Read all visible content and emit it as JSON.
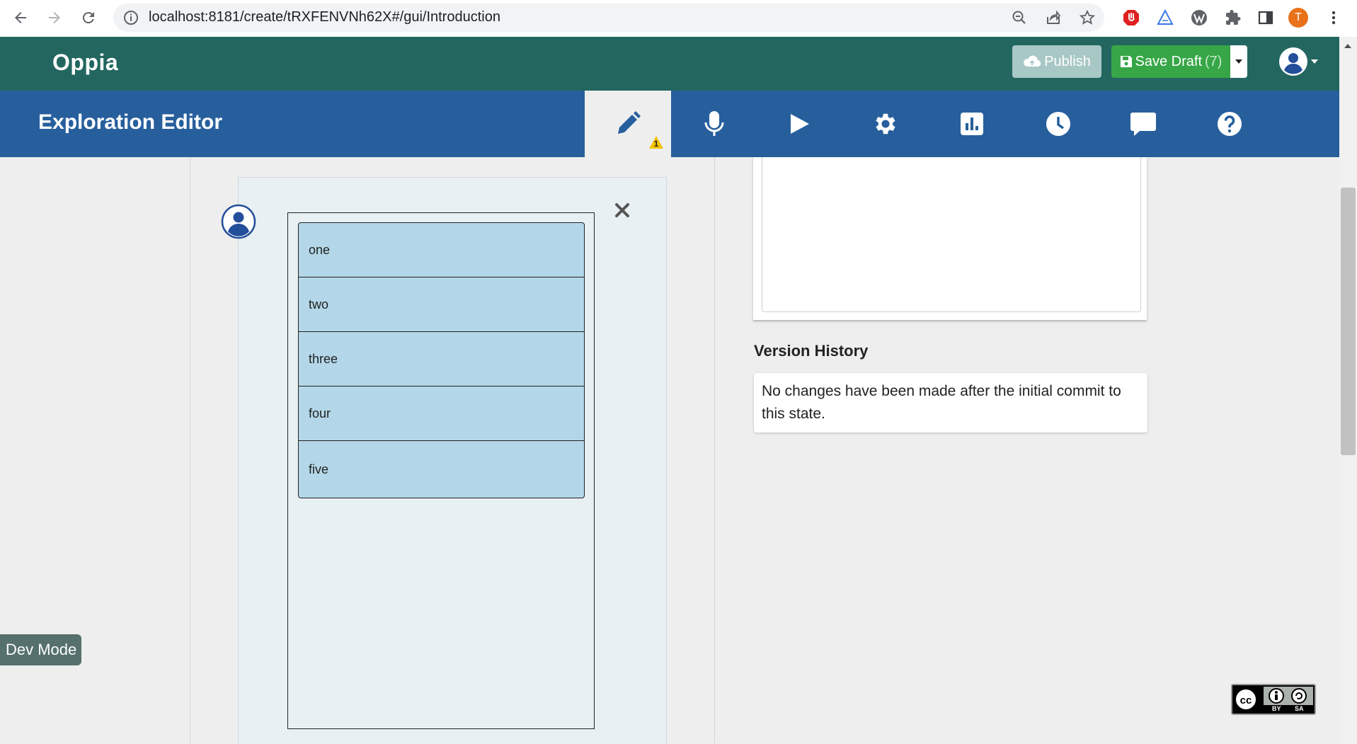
{
  "browser": {
    "url": "localhost:8181/create/tRXFENVNh62X#/gui/Introduction",
    "profile_initial": "T"
  },
  "header": {
    "logo": "Oppia",
    "publish_label": "Publish",
    "save_label": "Save Draft",
    "save_count": "(7)"
  },
  "editor": {
    "title": "Exploration Editor",
    "warning_count": "1",
    "tabs": [
      "edit",
      "translate",
      "preview",
      "settings",
      "stats",
      "history",
      "feedback",
      "help"
    ]
  },
  "preview": {
    "items": [
      "one",
      "two",
      "three",
      "four",
      "five"
    ]
  },
  "version_history": {
    "title": "Version History",
    "text": "No changes have been made after the initial commit to this state."
  },
  "dev_mode_label": "Dev Mode",
  "license": {
    "by": "BY",
    "sa": "SA"
  },
  "colors": {
    "header_green": "#236660",
    "editor_blue": "#275f9d",
    "save_green": "#37a647",
    "item_blue": "#b3d7e8"
  }
}
